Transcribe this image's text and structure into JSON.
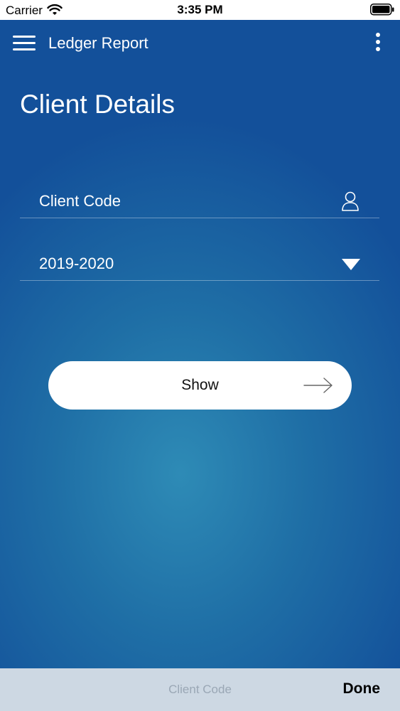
{
  "status_bar": {
    "carrier": "Carrier",
    "time": "3:35 PM"
  },
  "nav": {
    "title": "Ledger Report",
    "menu_icon": "hamburger-menu-icon",
    "more_icon": "more-vertical-icon"
  },
  "page": {
    "title": "Client Details"
  },
  "form": {
    "client_code_placeholder": "Client Code",
    "client_icon": "user-icon",
    "year_value": "2019-2020",
    "year_icon": "dropdown-triangle-icon"
  },
  "show_button": {
    "label": "Show",
    "icon": "arrow-right-icon"
  },
  "keyboard_bar": {
    "placeholder": "Client Code",
    "done_label": "Done"
  },
  "colors": {
    "background_dark": "#13509a",
    "background_light": "#2e8bb6",
    "button_bg": "#ffffff",
    "keyboard_bar_bg": "#cdd8e3"
  }
}
